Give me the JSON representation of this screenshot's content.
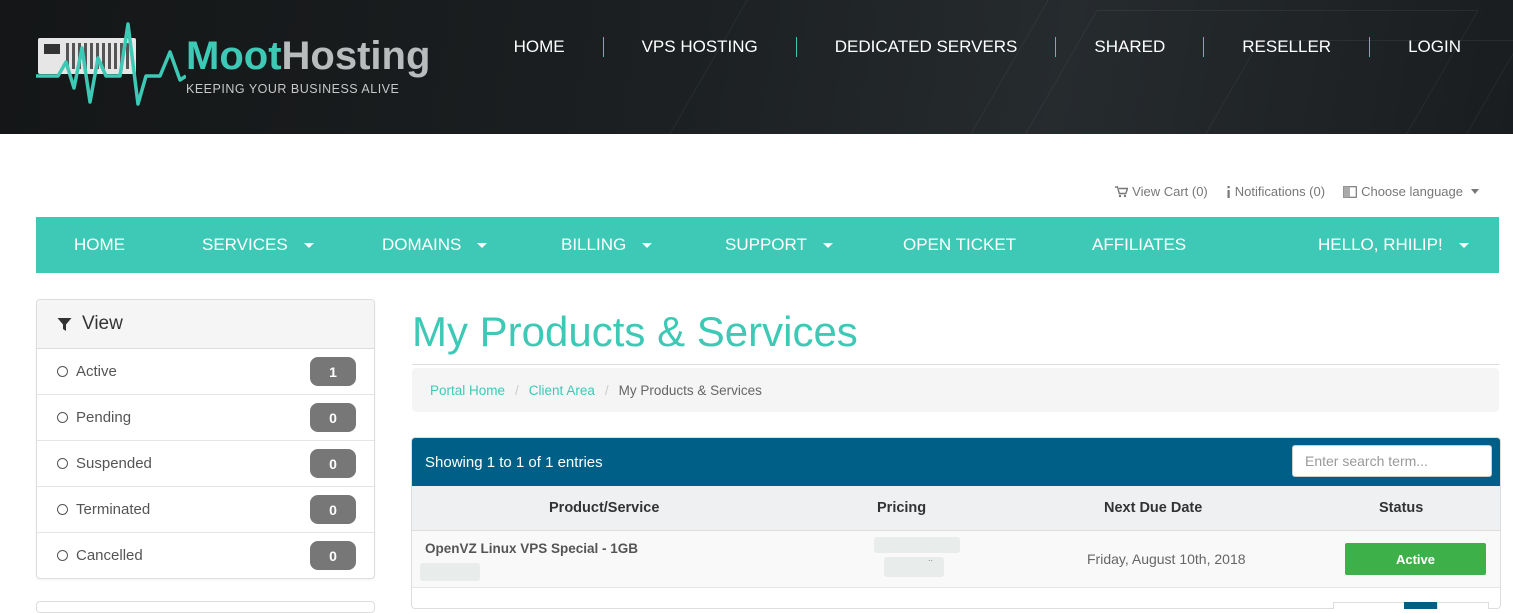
{
  "brand": {
    "name_part1": "Moot",
    "name_part2": "Hosting",
    "tagline": "KEEPING YOUR BUSINESS ALIVE",
    "accent": "#3ec9b6"
  },
  "main_nav": [
    "HOME",
    "VPS HOSTING",
    "DEDICATED SERVERS",
    "SHARED",
    "RESELLER",
    "LOGIN"
  ],
  "utility": {
    "cart": "View Cart (0)",
    "notifications": "Notifications (0)",
    "language": "Choose language"
  },
  "client_nav": [
    {
      "label": "HOME",
      "dropdown": false
    },
    {
      "label": "SERVICES",
      "dropdown": true
    },
    {
      "label": "DOMAINS",
      "dropdown": true
    },
    {
      "label": "BILLING",
      "dropdown": true
    },
    {
      "label": "SUPPORT",
      "dropdown": true
    },
    {
      "label": "OPEN TICKET",
      "dropdown": false
    },
    {
      "label": "AFFILIATES",
      "dropdown": false
    },
    {
      "label": "HELLO, RHILIP!",
      "dropdown": true
    }
  ],
  "sidebar": {
    "title": "View",
    "items": [
      {
        "label": "Active",
        "count": "1"
      },
      {
        "label": "Pending",
        "count": "0"
      },
      {
        "label": "Suspended",
        "count": "0"
      },
      {
        "label": "Terminated",
        "count": "0"
      },
      {
        "label": "Cancelled",
        "count": "0"
      }
    ]
  },
  "page": {
    "title": "My Products & Services",
    "breadcrumb": [
      "Portal Home",
      "Client Area",
      "My Products & Services"
    ]
  },
  "table": {
    "showing": "Showing 1 to 1 of 1 entries",
    "search_placeholder": "Enter search term...",
    "columns": [
      "Product/Service",
      "Pricing",
      "Next Due Date",
      "Status"
    ],
    "rows": [
      {
        "product": "OpenVZ Linux VPS Special - 1GB",
        "pricing": "..",
        "due": "Friday, August 10th, 2018",
        "status": "Active"
      }
    ],
    "status_color": "#3eb04a",
    "header_color": "#005f87"
  }
}
